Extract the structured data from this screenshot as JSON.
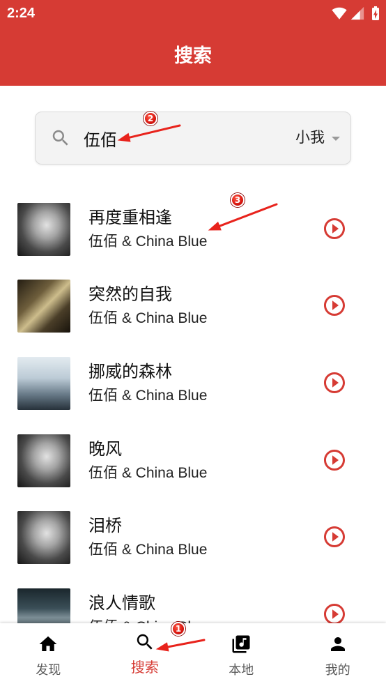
{
  "colors": {
    "accent": "#d63b34",
    "text_primary": "#111111",
    "text_inactive": "#5a5a5a",
    "annotation": "#e8231c"
  },
  "status_bar": {
    "time": "2:24",
    "icons": [
      "wifi-icon",
      "cell-signal-icon",
      "battery-charging-icon"
    ]
  },
  "app_bar": {
    "title": "搜索"
  },
  "search": {
    "icon": "search-icon",
    "query": "伍佰",
    "scope": "小我"
  },
  "songs": [
    {
      "title": "再度重相逢",
      "artist": "伍佰 & China Blue",
      "action_icon": "play-circle-icon"
    },
    {
      "title": "突然的自我",
      "artist": "伍佰 & China Blue",
      "action_icon": "play-circle-icon"
    },
    {
      "title": "挪威的森林",
      "artist": "伍佰 & China Blue",
      "action_icon": "play-circle-icon"
    },
    {
      "title": "晚风",
      "artist": "伍佰 & China Blue",
      "action_icon": "play-circle-icon"
    },
    {
      "title": "泪桥",
      "artist": "伍佰 & China Blue",
      "action_icon": "play-circle-icon"
    },
    {
      "title": "浪人情歌",
      "artist": "伍佰 & China Blue",
      "action_icon": "play-circle-icon"
    }
  ],
  "bottom_nav": [
    {
      "label": "发现",
      "icon": "home-icon",
      "active": false
    },
    {
      "label": "搜索",
      "icon": "search-icon",
      "active": true
    },
    {
      "label": "本地",
      "icon": "library-music-icon",
      "active": false
    },
    {
      "label": "我的",
      "icon": "person-icon",
      "active": false
    }
  ],
  "annotations": [
    {
      "label": "1"
    },
    {
      "label": "2"
    },
    {
      "label": "3"
    }
  ]
}
